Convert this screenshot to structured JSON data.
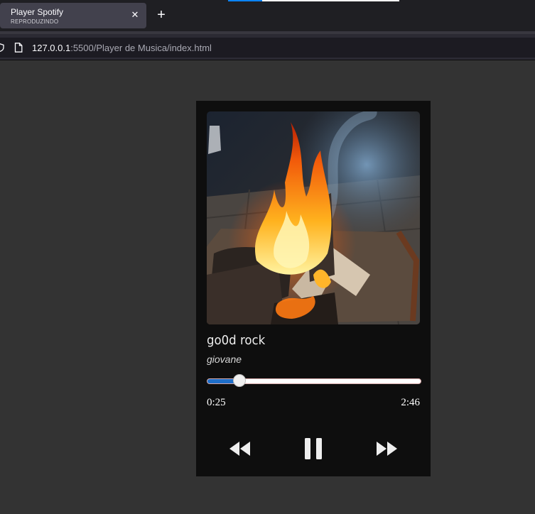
{
  "browser": {
    "tab": {
      "title": "Player Spotify",
      "subtitle": "REPRODUZINDO",
      "close_icon": "close-icon"
    },
    "new_tab_icon": "plus-icon",
    "url_host": "127.0.0.1",
    "url_rest": ":5500/Player de Musica/index.html"
  },
  "player": {
    "album_art": "campfire-photo",
    "song_title": "go0d rock",
    "artist": "giovane",
    "progress": {
      "current_time": "0:25",
      "total_time": "2:46",
      "fraction": 0.1506,
      "fill_color": "#1f6fc9"
    },
    "controls": {
      "previous_icon": "rewind-icon",
      "play_pause_icon": "pause-icon",
      "next_icon": "fast-forward-icon"
    }
  }
}
